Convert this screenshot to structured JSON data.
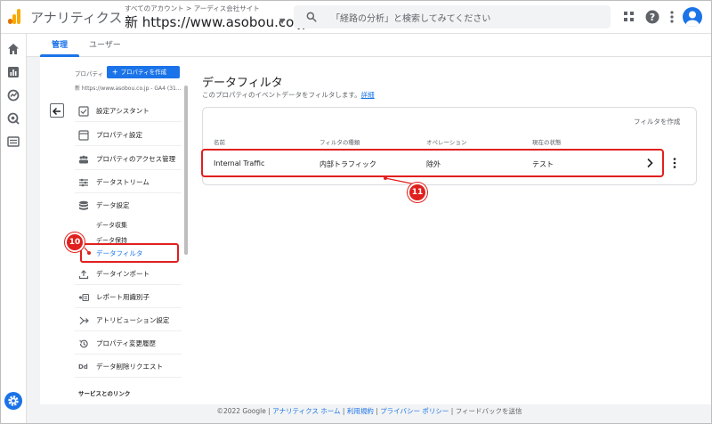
{
  "header": {
    "app_title": "アナリティクス",
    "account_crumb": "すべてのアカウント > アーディス会社サイト",
    "property_name": "新 https://www.asobou.co.jp...",
    "search_placeholder": "「経路の分析」と検索してみてください"
  },
  "tabs": [
    {
      "label": "管理",
      "active": true
    },
    {
      "label": "ユーザー",
      "active": false
    }
  ],
  "sidebar": {
    "property_label": "プロパティ",
    "create_property": "プロパティを作成",
    "property_url": "新 https://www.asobou.co.jp - GA4 (31...",
    "items": [
      {
        "label": "設定アシスタント",
        "icon": "checkbox-icon"
      },
      {
        "label": "プロパティ設定",
        "icon": "property-icon"
      },
      {
        "label": "プロパティのアクセス管理",
        "icon": "people-icon"
      },
      {
        "label": "データストリーム",
        "icon": "streams-icon"
      },
      {
        "label": "データ設定",
        "icon": "database-icon"
      }
    ],
    "sub_items": [
      "データ収集",
      "データ保持",
      "データフィルタ"
    ],
    "items_after": [
      {
        "label": "データインポート",
        "icon": "upload-icon"
      },
      {
        "label": "レポート用識別子",
        "icon": "identifier-icon"
      },
      {
        "label": "アトリビューション設定",
        "icon": "attribution-icon"
      },
      {
        "label": "プロパティ変更履歴",
        "icon": "history-icon"
      },
      {
        "label": "データ削除リクエスト",
        "icon": "dd-icon"
      }
    ],
    "section_label": "サービスとのリンク"
  },
  "main": {
    "title": "データフィルタ",
    "subtitle": "このプロパティのイベントデータをフィルタします。",
    "learn_more": "詳細",
    "create_filter": "フィルタを作成",
    "columns": [
      "名前",
      "フィルタの種類",
      "オペレーション",
      "現在の状態"
    ],
    "rows": [
      {
        "name": "Internal Traffic",
        "type": "内部トラフィック",
        "operation": "除外",
        "state": "テスト"
      }
    ]
  },
  "annotations": {
    "badge_a": "10",
    "badge_b": "11"
  },
  "footer": {
    "copyright": "©2022 Google",
    "home": "アナリティクス ホーム",
    "terms": "利用規約",
    "privacy": "プライバシー ポリシー",
    "feedback": "フィードバックを送信",
    "sep": "|"
  },
  "colors": {
    "accent": "#1a73e8",
    "annotation": "#e0201e",
    "logo_orange": "#f9ab00"
  }
}
